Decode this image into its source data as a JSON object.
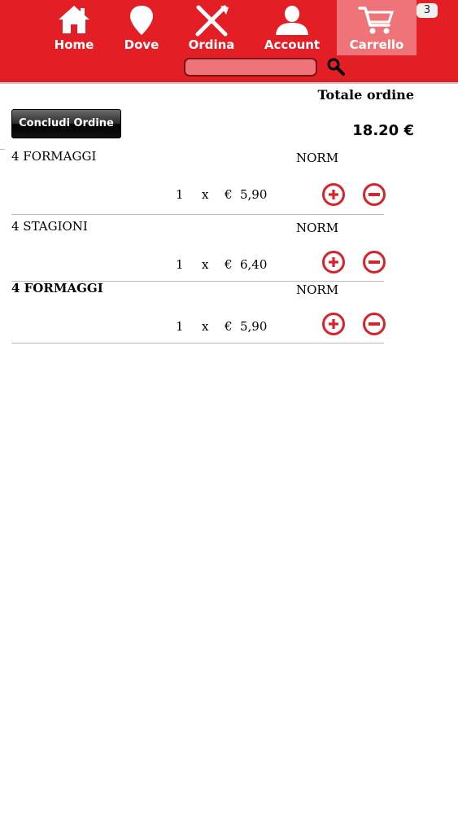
{
  "nav": {
    "items": [
      {
        "label": "Home",
        "icon": "home-icon"
      },
      {
        "label": "Dove",
        "icon": "map-pin-icon"
      },
      {
        "label": "Ordina",
        "icon": "fork-knife-icon"
      },
      {
        "label": "Account",
        "icon": "user-icon"
      },
      {
        "label": "Carrello",
        "icon": "cart-icon",
        "active": true
      }
    ],
    "cart_count": "3"
  },
  "search": {
    "placeholder": "",
    "icon": "search-icon"
  },
  "order": {
    "total_label": "Totale ordine",
    "total_value": "18.20 €",
    "checkout_label": "Concludi Ordine",
    "items": [
      {
        "name": "4 FORMAGGI",
        "size": "NORM",
        "qty": "1",
        "times": "x",
        "currency": "€",
        "price": "5,90",
        "bold": false
      },
      {
        "name": "4 STAGIONI",
        "size": "NORM",
        "qty": "1",
        "times": "x",
        "currency": "€",
        "price": "6,40",
        "bold": false
      },
      {
        "name": "4 FORMAGGI",
        "size": "NORM",
        "qty": "1",
        "times": "x",
        "currency": "€",
        "price": "5,90",
        "bold": true
      }
    ]
  },
  "colors": {
    "brand": "#e31e25",
    "active_tab": "#ee7479",
    "action_red": "#d9222a"
  }
}
